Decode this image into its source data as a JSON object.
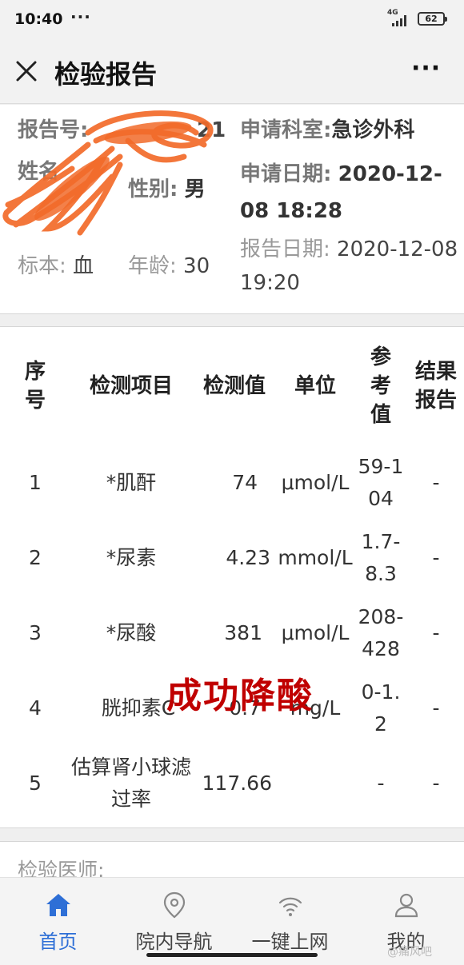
{
  "status_bar": {
    "time": "10:40",
    "dots": "···",
    "network": "4G",
    "battery": "62"
  },
  "header": {
    "title": "检验报告"
  },
  "info": {
    "report_no_label": "报告号:",
    "report_no_value": "21",
    "name_label": "姓名",
    "gender_label": "性别:",
    "gender_value": "男",
    "specimen_label": "标本:",
    "specimen_value": "血",
    "age_label": "年龄:",
    "age_value": "30",
    "dept_label": "申请科室:",
    "dept_value": "急诊外科",
    "apply_date_label": "申请日期:",
    "apply_date_value": "2020-12-08 18:28",
    "report_date_label": "报告日期:",
    "report_date_value": "2020-12-08 19:20"
  },
  "table": {
    "headers": [
      "序号",
      "检测项目",
      "检测值",
      "单位",
      "参考值",
      "结果报告"
    ],
    "rows": [
      {
        "no": "1",
        "item": "*肌酐",
        "value": "74",
        "unit": "μmol/L",
        "ref": "59-104",
        "result": "-"
      },
      {
        "no": "2",
        "item": "*尿素",
        "value": "4.23",
        "unit": "mmol/L",
        "ref": "1.7-8.3",
        "result": "-"
      },
      {
        "no": "3",
        "item": "*尿酸",
        "value": "381",
        "unit": "μmol/L",
        "ref": "208-428",
        "result": "-"
      },
      {
        "no": "4",
        "item": "胱抑素C",
        "value": "0.7",
        "unit": "mg/L",
        "ref": "0-1.2",
        "result": "-"
      },
      {
        "no": "5",
        "item": "估算肾小球滤过率",
        "value": "117.66",
        "unit": "",
        "ref": "-",
        "result": "-"
      }
    ]
  },
  "overlay_text": "成功降酸",
  "doctor": {
    "label": "检验医师:"
  },
  "nav": {
    "items": [
      {
        "label": "首页",
        "icon": "home-icon"
      },
      {
        "label": "院内导航",
        "icon": "location-pin-icon"
      },
      {
        "label": "一键上网",
        "icon": "wifi-icon"
      },
      {
        "label": "我的",
        "icon": "person-icon"
      }
    ],
    "active_color": "#2e6fd6"
  },
  "watermark": "@痛风吧"
}
